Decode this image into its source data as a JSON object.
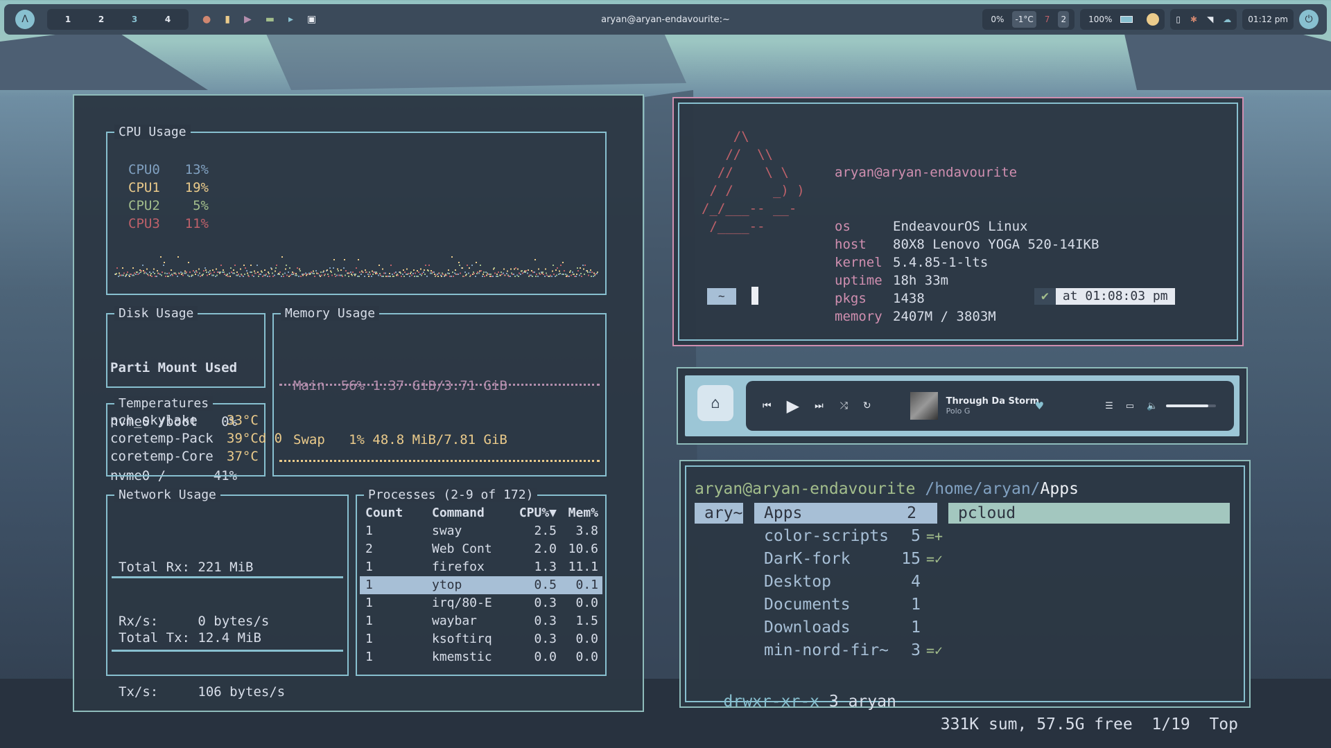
{
  "topbar": {
    "workspaces": [
      "1",
      "2",
      "3",
      "4"
    ],
    "window_title": "aryan@aryan-endavourite:~",
    "cpu_percent": "0%",
    "temp": "-1°C",
    "updates": "7",
    "notifications": "2",
    "battery": "100%",
    "clock": "01:12 pm"
  },
  "ytop": {
    "cpu": {
      "title": "CPU Usage",
      "lines": [
        {
          "label": "CPU0",
          "value": "13%",
          "color": "#81a1c1"
        },
        {
          "label": "CPU1",
          "value": "19%",
          "color": "#ebcb8b"
        },
        {
          "label": "CPU2",
          "value": "5%",
          "color": "#a3be8c"
        },
        {
          "label": "CPU3",
          "value": "11%",
          "color": "#bf616a"
        }
      ]
    },
    "disk": {
      "title": "Disk Usage",
      "header": "Parti Mount Used",
      "rows": [
        "nvme0 /boot   0%",
        "nvme0 /      41%"
      ]
    },
    "memory": {
      "title": "Memory Usage",
      "main": "Main  56% 1.37 GiB/3.71 GiB",
      "swap": "Swap   1% 48.8 MiB/7.81 GiB"
    },
    "temps": {
      "title": "Temperatures",
      "rows": [
        {
          "name": "pch_skylake",
          "value": "33°C"
        },
        {
          "name": "coretemp-Pack",
          "value": "39°Cd 0"
        },
        {
          "name": "coretemp-Core",
          "value": "37°C"
        }
      ]
    },
    "network": {
      "title": "Network Usage",
      "rx_total": "Total Rx: 221 MiB",
      "rx_rate": "Rx/s:     0 bytes/s",
      "tx_total": "Total Tx: 12.4 MiB",
      "tx_rate": "Tx/s:     106 bytes/s"
    },
    "processes": {
      "title": "Processes (2-9 of 172)",
      "columns": [
        "Count",
        "Command",
        "CPU%▼",
        "Mem%"
      ],
      "rows": [
        [
          "1",
          "sway",
          "2.5",
          "3.8"
        ],
        [
          "2",
          "Web Cont",
          "2.0",
          "10.6"
        ],
        [
          "1",
          "firefox",
          "1.3",
          "11.1"
        ],
        [
          "1",
          "ytop",
          "0.5",
          "0.1"
        ],
        [
          "1",
          "irq/80-E",
          "0.3",
          "0.0"
        ],
        [
          "1",
          "waybar",
          "0.3",
          "1.5"
        ],
        [
          "1",
          "ksoftirq",
          "0.3",
          "0.0"
        ],
        [
          "1",
          "kmemstic",
          "0.0",
          "0.0"
        ]
      ],
      "selected_row": 3
    }
  },
  "fetch": {
    "user": "aryan@aryan-endavourite",
    "ascii": [
      "    /\\",
      "   //  \\\\",
      "  //    \\ \\",
      " / /     _) )",
      "/_/___-- __-",
      " /____--"
    ],
    "fields": [
      {
        "key": "os",
        "value": "EndeavourOS Linux"
      },
      {
        "key": "host",
        "value": "80X8 Lenovo YOGA 520-14IKB"
      },
      {
        "key": "kernel",
        "value": "5.4.85-1-lts"
      },
      {
        "key": "uptime",
        "value": "18h 33m"
      },
      {
        "key": "pkgs",
        "value": "1438"
      },
      {
        "key": "memory",
        "value": "2407M / 3803M"
      }
    ],
    "prompt_dir": "~",
    "check": "✔",
    "time": "at 01:08:03 pm"
  },
  "player": {
    "track": "Through Da Storm",
    "artist": "Polo G",
    "volume_fraction": 0.85
  },
  "ranger": {
    "user": "aryan@aryan-endavourite",
    "path": "/home/aryan/",
    "current": "Apps",
    "parent": "ary~",
    "selected": {
      "name": "Apps",
      "count": "2"
    },
    "preview": "pcloud",
    "items": [
      {
        "name": "color-scripts",
        "count": "5",
        "flag": "=+"
      },
      {
        "name": "DarK-fork",
        "count": "15",
        "flag": "=✓"
      },
      {
        "name": "Desktop",
        "count": "4",
        "flag": ""
      },
      {
        "name": "Documents",
        "count": "1",
        "flag": ""
      },
      {
        "name": "Downloads",
        "count": "1",
        "flag": ""
      },
      {
        "name": "min-nord-fir~",
        "count": "3",
        "flag": "=✓"
      }
    ],
    "status_perm": "drwxr-xr-x",
    "status_rest": "3 aryan",
    "status_right": "331K sum, 57.5G free  1/19  Top"
  }
}
